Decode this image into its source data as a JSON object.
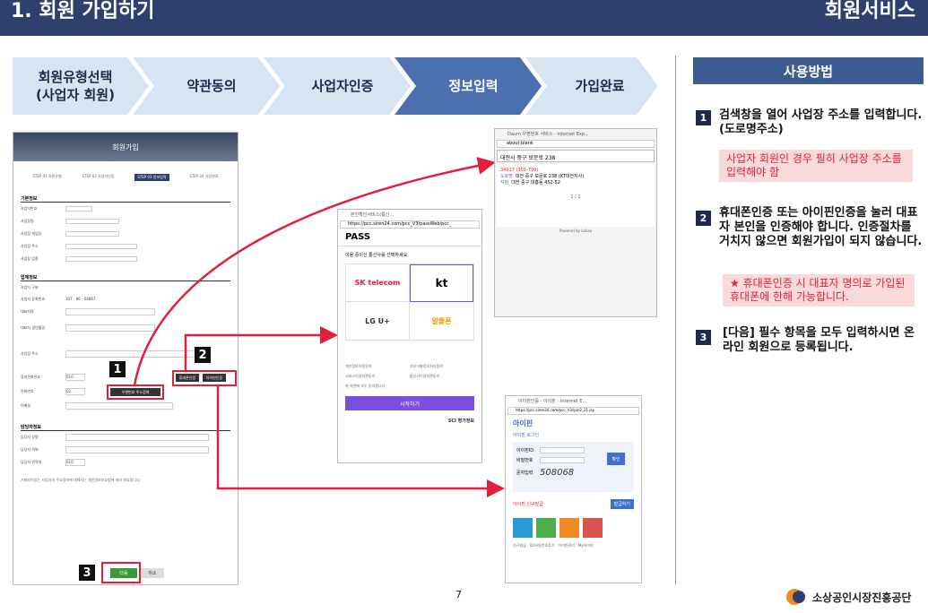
{
  "header": {
    "title": "1. 회원 가입하기",
    "section": "회원서비스"
  },
  "steps": [
    {
      "line1": "회원유형선택",
      "line2": "(사업자 회원)",
      "bg": "#d7e4f2",
      "color": "#1e2a4a"
    },
    {
      "line1": "약관동의",
      "line2": "",
      "bg": "#d7e4f2",
      "color": "#1e2a4a"
    },
    {
      "line1": "사업자인증",
      "line2": "",
      "bg": "#d7e4f2",
      "color": "#1e2a4a"
    },
    {
      "line1": "정보입력",
      "line2": "",
      "bg": "#4c6fb0",
      "color": "#ffffff"
    },
    {
      "line1": "가입완료",
      "line2": "",
      "bg": "#d7e4f2",
      "color": "#1e2a4a"
    }
  ],
  "form": {
    "banner": "회원가입",
    "tabs": [
      "STEP 01 회원유형",
      "STEP 02 사업자인증",
      "STEP 03 정보입력",
      "STEP 04 가입완료"
    ],
    "section_basic": "기본정보",
    "section_biz": "업체정보",
    "section_manager": "담당자정보",
    "basic_rows": [
      "사업자번호",
      "사업장명",
      "사업장 개업일",
      "사업장 주소",
      "사업장 업종"
    ],
    "biz_rows": [
      "사업자 구분",
      "사업자 등록번호",
      "대표자명",
      "대표자 생년월일",
      "사업장 주소",
      "휴대전화번호",
      "전화번호",
      "이메일"
    ],
    "manager_rows": [
      "담당자 성명",
      "담당자 직위",
      "담당자 연락처"
    ],
    "biz_number": "107 - 86 - 04867",
    "phone_select": "010",
    "phone_select2": "02",
    "zip_button": "우편번호 주소검색",
    "cert_phone_button": "휴대폰인증",
    "ipin_button": "아이핀인증",
    "next_button": "다음",
    "cancel_button": "취소",
    "footnote": "기재되어있는 사업자의 주요정보에 대해서는 개인정보보호법에 따라 보호됩니다."
  },
  "badges": {
    "b1": "1",
    "b2": "2",
    "b3": "3"
  },
  "daum": {
    "title": "Daum 우편번호 서비스 - Internet Exp...",
    "address_bar": "about:blank",
    "query": "대전시 중구 보문로 238",
    "result_code": "34917 (301-799)",
    "road_tag": "도로명",
    "road": "대전 중구 보문로 238 (KT대전지사)",
    "jibun_tag": "지번",
    "jibun": "대전 중구 대흥동 452-52",
    "pager": "1 / 1",
    "powered": "Powered by kakao"
  },
  "pass": {
    "title": "본인확인서비스(통신...",
    "url": "https://pcc.siren24.com/pcc_V3/passWeb/pcc_",
    "brand": "PASS",
    "prompt": "이용 중이신 통신사를 선택하세요.",
    "carriers": [
      "SK telecom",
      "kt",
      "LG U+",
      "알뜰폰"
    ],
    "agree": [
      "개인정보이용동의",
      "고유식별정보처리동의",
      "서비스이용약관동의",
      "통신사이용약관동의"
    ],
    "agree_all": "위 약관에 모두 동의합니다",
    "start": "시작하기",
    "footer": "SCI 평가정보"
  },
  "ipin": {
    "title": "아이핀인증 - 아이핀 - Internet E...",
    "url": "https://pcc.siren24.com/pcc_V3/ipin2_21.jsp",
    "brand": "아이핀",
    "login_label": "아이핀 로그인",
    "id_label": "아이핀ID",
    "pw_label": "비밀번호",
    "captcha_label": "문자입력",
    "captcha": "508068",
    "confirm": "확인",
    "new_label": "아이핀 신규발급",
    "issue": "발급하기",
    "menu": [
      "신규발급",
      "ID/비밀번호찾기",
      "아이핀관리",
      "My아이핀"
    ]
  },
  "guide": {
    "title": "사용방법",
    "items": [
      {
        "num": "1",
        "text": "검색창을 열어 사업장 주소를 입력합니다. (도로명주소)",
        "note": "사업자 회원인 경우 필히 사업장 주소를 입력해야 함"
      },
      {
        "num": "2",
        "text": "휴대폰인증 또는 아이핀인증을 눌러 대표자 본인을 인증해야 합니다. 인증절차를 거치지 않으면 회원가입이 되지 않습니다.",
        "note": "★ 휴대폰인증 시 대표자 명의로 가입된 휴대폰에 한해 가능합니다."
      },
      {
        "num": "3",
        "text": "[다음] 필수 항목을 모두 입력하시면 온라인 회원으로 등록됩니다.",
        "note": ""
      }
    ]
  },
  "footer": {
    "page": "7",
    "org": "소상공인시장진흥공단"
  },
  "colors": {
    "header": "#2f3f6e",
    "accent_red": "#e0203a",
    "guide_header": "#3d5a91"
  }
}
